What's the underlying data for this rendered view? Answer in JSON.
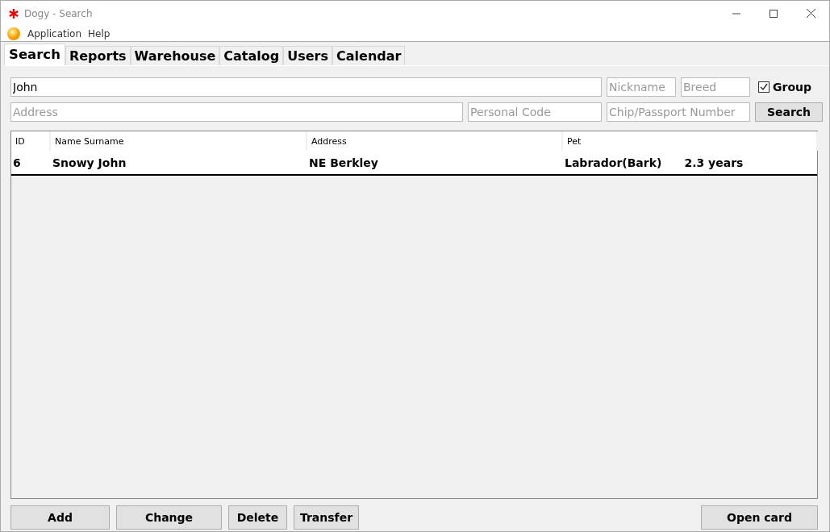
{
  "window": {
    "title": "Dogy - Search"
  },
  "menu": [
    {
      "label": "Application"
    },
    {
      "label": "Help"
    }
  ],
  "tabs": [
    {
      "label": "Search",
      "selected": true
    },
    {
      "label": "Reports",
      "selected": false
    },
    {
      "label": "Warehouse",
      "selected": false
    },
    {
      "label": "Catalog",
      "selected": false
    },
    {
      "label": "Users",
      "selected": false
    },
    {
      "label": "Calendar",
      "selected": false
    }
  ],
  "filters": {
    "name": {
      "value": "John"
    },
    "nickname": {
      "placeholder": "Nickname"
    },
    "breed": {
      "placeholder": "Breed"
    },
    "group": {
      "label": "Group",
      "checked": true
    },
    "address": {
      "placeholder": "Address"
    },
    "personal_code": {
      "placeholder": "Personal Code"
    },
    "chip": {
      "placeholder": "Chip/Passport Number"
    },
    "search_button": "Search"
  },
  "table": {
    "columns": [
      "ID",
      "Name Surname",
      "Address",
      "Pet"
    ],
    "rows": [
      {
        "id": "6",
        "name": "Snowy John",
        "address": "NE Berkley",
        "pet": "Labrador(Bark)",
        "age": "2.3 years"
      }
    ]
  },
  "buttons": [
    {
      "label": "Add"
    },
    {
      "label": "Change"
    },
    {
      "label": "Delete"
    },
    {
      "label": "Transfer"
    },
    {
      "label": "Open card"
    }
  ]
}
